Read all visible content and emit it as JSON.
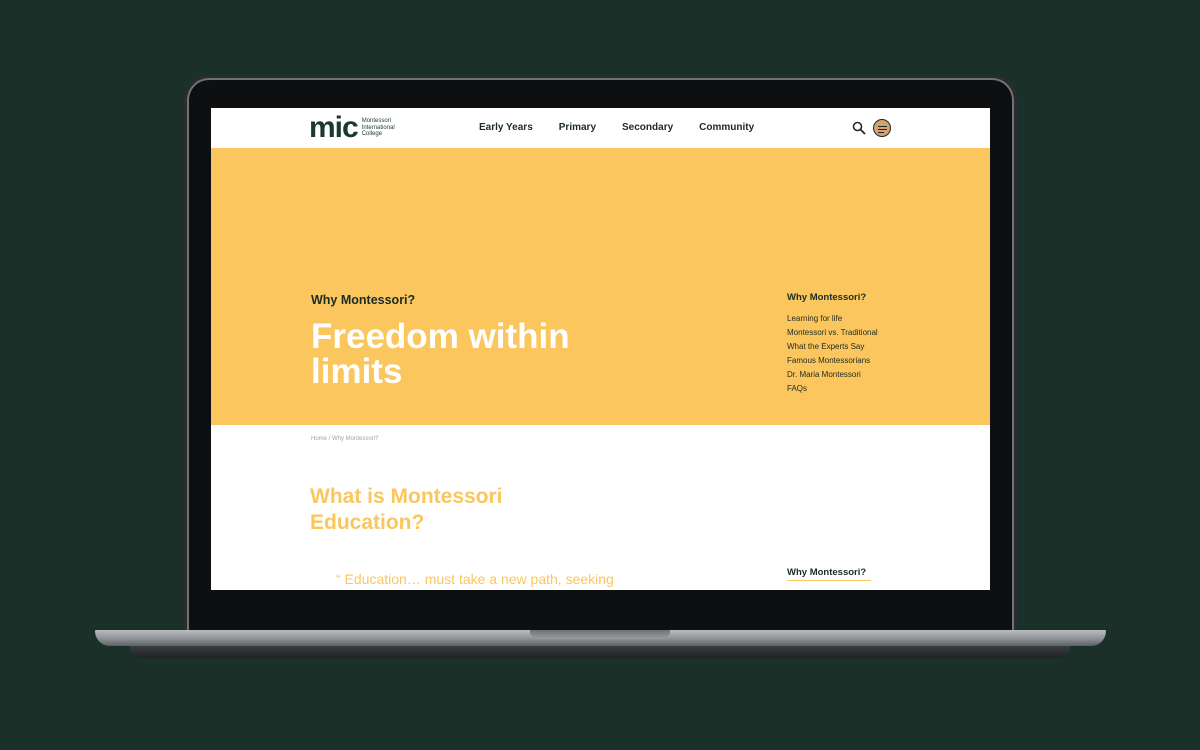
{
  "header": {
    "logo_mark": "mic",
    "logo_text": "Montessori International College",
    "nav": [
      "Early Years",
      "Primary",
      "Secondary",
      "Community"
    ],
    "icons": {
      "search": "search-icon",
      "menu": "menu-icon"
    }
  },
  "hero": {
    "eyebrow": "Why Montessori?",
    "title": "Freedom within limits",
    "side_nav_title": "Why Montessori?",
    "side_nav_items": [
      "Learning for life",
      "Montessori vs. Traditional",
      "What the Experts Say",
      "Famous Montessorians",
      "Dr. Maria Montessori",
      "FAQs"
    ]
  },
  "breadcrumb": "Home / Why Montessori?",
  "content": {
    "section_title": "What is Montessori Education?",
    "quote": "“ Education… must take a new path, seeking",
    "side_title": "Why Montessori?"
  },
  "colors": {
    "background": "#1b3029",
    "accent_yellow": "#fbc65d",
    "dark_green": "#1c3a2c",
    "menu_button": "#d6a173"
  }
}
